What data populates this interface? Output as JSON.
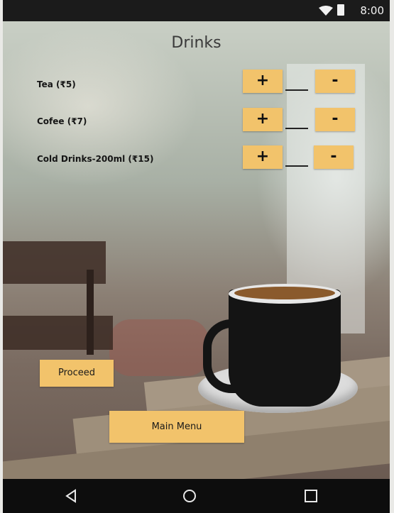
{
  "status_bar": {
    "time": "8:00",
    "icons": [
      "wifi-icon",
      "battery-icon"
    ]
  },
  "screen": {
    "title": "Drinks"
  },
  "items": [
    {
      "label": "Tea (₹5)",
      "plus": "+",
      "minus": "-"
    },
    {
      "label": "Cofee (₹7)",
      "plus": "+",
      "minus": "-"
    },
    {
      "label": "Cold Drinks-200ml (₹15)",
      "plus": "+",
      "minus": "-"
    }
  ],
  "actions": {
    "proceed": "Proceed",
    "main_menu": "Main Menu"
  },
  "nav": {
    "icons": [
      "back-icon",
      "home-icon",
      "recents-icon"
    ]
  },
  "colors": {
    "accent": "#f2c36b",
    "status_bar": "#1b1b1b",
    "nav_bar": "#0d0d0d"
  }
}
